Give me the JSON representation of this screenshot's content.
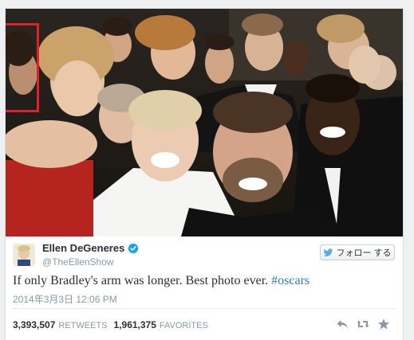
{
  "tweet": {
    "author_name": "Ellen DeGeneres",
    "handle": "@TheEllenShow",
    "follow_label": "フォロー する",
    "text": "If only Bradley's arm was longer. Best photo ever.",
    "hashtag": "#oscars",
    "date": "2014年3月3日 12:06 PM",
    "retweets_count": "3,393,507",
    "retweets_label": "RETWEETS",
    "favorites_count": "1,961,375",
    "favorites_label": "FAVORITES"
  },
  "colors": {
    "highlight_box": "#e0202a",
    "hashtag": "#2b7bb9",
    "verified": "#1da1f2"
  },
  "icons": [
    "verified-badge-icon",
    "twitter-bird-icon",
    "reply-icon",
    "retweet-icon",
    "favorite-star-icon"
  ]
}
